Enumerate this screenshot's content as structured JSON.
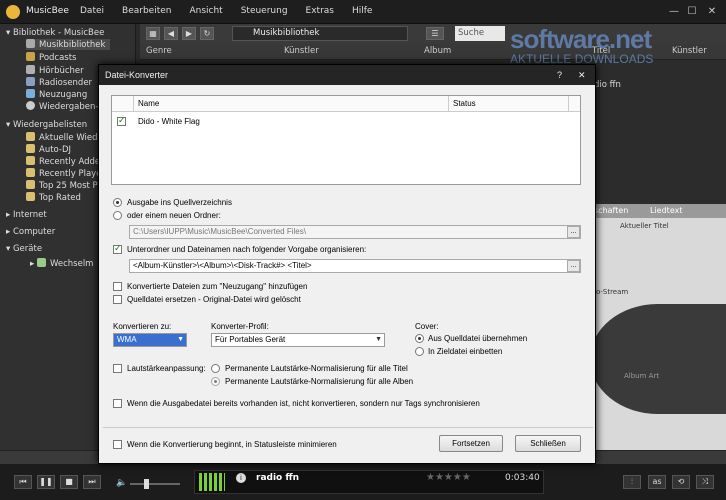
{
  "app": {
    "title": "MusicBee",
    "menu": [
      "Datei",
      "Bearbeiten",
      "Ansicht",
      "Steuerung",
      "Extras",
      "Hilfe"
    ]
  },
  "sidebar": {
    "library_header": "Bibliothek - MusicBee",
    "library_items": [
      "Musikbibliothek",
      "Podcasts",
      "Hörbücher",
      "Radiosender",
      "Neuzugang",
      "Wiedergaben-"
    ],
    "playlists_header": "Wiedergabelisten",
    "playlist_items": [
      "Aktuelle Wied",
      "Auto-DJ",
      "Recently Adde",
      "Recently Playe",
      "Top 25 Most P",
      "Top Rated"
    ],
    "internet": "Internet",
    "computer": "Computer",
    "devices": "Geräte",
    "device_item": "Wechselm"
  },
  "toolbar": {
    "path": "Musikbibliothek",
    "search_placeholder": "Suche"
  },
  "columns": {
    "genre": "Genre",
    "artist": "Künstler",
    "album": "Album",
    "title": "Titel",
    "artist2": "Künstler"
  },
  "right_panel": {
    "tab1": "schaften",
    "tab2": "Liedtext",
    "current_title": "Aktueller Titel",
    "station": "dio ffn",
    "stream": "io-Stream",
    "album_art": "Album Art"
  },
  "watermark": {
    "line1": "software.net",
    "line2": "AKTUELLE DOWNLOADS"
  },
  "dialog": {
    "title": "Datei-Konverter",
    "help": "?",
    "close": "✕",
    "list_header_name": "Name",
    "list_header_status": "Status",
    "list_row": "Dido - White Flag",
    "output_source": "Ausgabe ins Quellverzeichnis",
    "output_new": "oder einem neuen Ordner:",
    "output_path": "C:\\Users\\IUPP\\Music\\MusicBee\\Converted Files\\",
    "organize_label": "Unterordner und Dateinamen nach folgender Vorgabe organisieren:",
    "organize_pattern": "<Album-Künstler>\\<Album>\\<Disk-Track#> <Titel>",
    "add_inbox": "Konvertierte Dateien zum \"Neuzugang\" hinzufügen",
    "replace_source": "Quelldatei ersetzen  - Original-Datei wird gelöscht",
    "convert_to_label": "Konvertieren zu:",
    "convert_to_value": "WMA",
    "profile_label": "Konverter-Profil:",
    "profile_value": "Für Portables Gerät",
    "cover_label": "Cover:",
    "cover_opt1": "Aus Quelldatei übernehmen",
    "cover_opt2": "In Zieldatei einbetten",
    "volume_label": "Lautstärkeanpassung:",
    "volume_opt1": "Permanente Lautstärke-Normalisierung für alle Titel",
    "volume_opt2": "Permanente Lautstärke-Normalisierung für alle Alben",
    "skip_existing": "Wenn die Ausgabedatei bereits vorhanden ist, nicht konvertieren, sondern nur Tags synchronisieren",
    "minimize": "Wenn die Konvertierung beginnt, in Statusleiste minimieren",
    "continue_btn": "Fortsetzen",
    "close_btn": "Schließen"
  },
  "player": {
    "station": "radio ffn",
    "time": "0:03:40",
    "stars": "★★★★★"
  }
}
